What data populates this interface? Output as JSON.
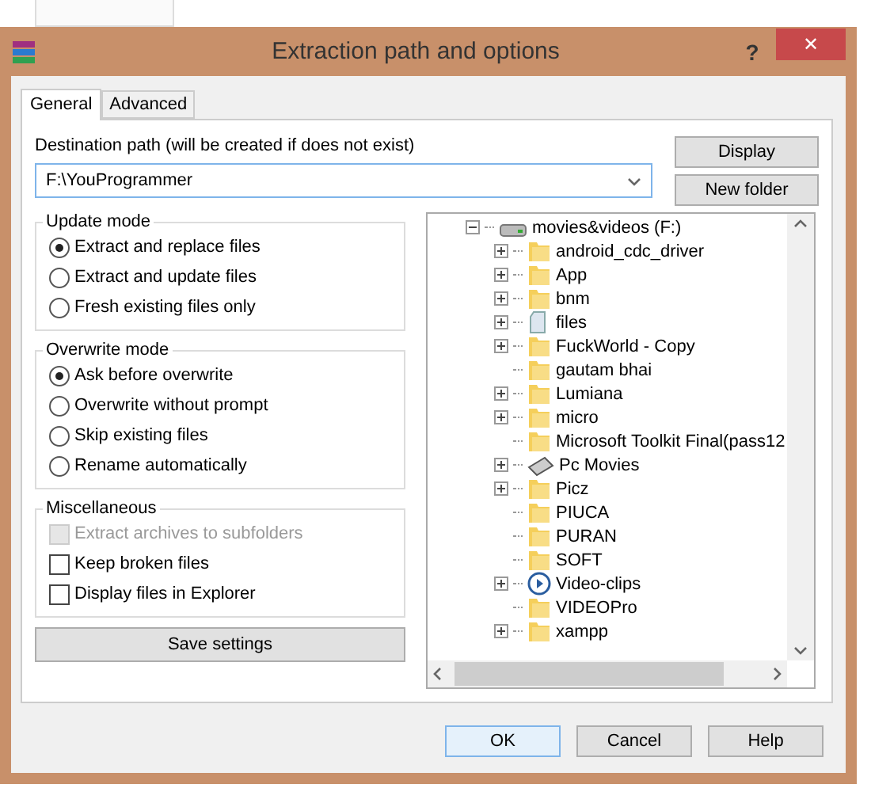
{
  "window": {
    "title": "Extraction path and options",
    "help_label": "?",
    "close_label": "✕"
  },
  "tabs": [
    {
      "label": "General",
      "selected": true
    },
    {
      "label": "Advanced",
      "selected": false
    }
  ],
  "destination": {
    "label": "Destination path (will be created if does not exist)",
    "value": "F:\\YouProgrammer"
  },
  "side_buttons": [
    "Display",
    "New folder"
  ],
  "groups": [
    {
      "title": "Update mode",
      "options": [
        {
          "kind": "radio",
          "label": "Extract and replace files",
          "selected": true,
          "disabled": false
        },
        {
          "kind": "radio",
          "label": "Extract and update files",
          "selected": false,
          "disabled": false
        },
        {
          "kind": "radio",
          "label": "Fresh existing files only",
          "selected": false,
          "disabled": false
        }
      ]
    },
    {
      "title": "Overwrite mode",
      "options": [
        {
          "kind": "radio",
          "label": "Ask before overwrite",
          "selected": true,
          "disabled": false
        },
        {
          "kind": "radio",
          "label": "Overwrite without prompt",
          "selected": false,
          "disabled": false
        },
        {
          "kind": "radio",
          "label": "Skip existing files",
          "selected": false,
          "disabled": false
        },
        {
          "kind": "radio",
          "label": "Rename automatically",
          "selected": false,
          "disabled": false
        }
      ]
    },
    {
      "title": "Miscellaneous",
      "options": [
        {
          "kind": "checkbox",
          "label": "Extract archives to subfolders",
          "checked": false,
          "disabled": true
        },
        {
          "kind": "checkbox",
          "label": "Keep broken files",
          "checked": false,
          "disabled": false
        },
        {
          "kind": "checkbox",
          "label": "Display files in Explorer",
          "checked": false,
          "disabled": false
        }
      ]
    }
  ],
  "save_button": "Save settings",
  "tree": [
    {
      "label": "movies&videos (F:)",
      "kind": "drive",
      "expanded": true,
      "children": [
        {
          "label": "android_cdc_driver",
          "kind": "folder",
          "expandable": true
        },
        {
          "label": "App",
          "kind": "folder",
          "expandable": true
        },
        {
          "label": "bnm",
          "kind": "folder",
          "expandable": true
        },
        {
          "label": "files",
          "kind": "document",
          "expandable": true
        },
        {
          "label": "FuckWorld - Copy",
          "kind": "folder",
          "expandable": true
        },
        {
          "label": "gautam bhai",
          "kind": "folder",
          "expandable": false
        },
        {
          "label": "Lumiana",
          "kind": "folder",
          "expandable": true
        },
        {
          "label": "micro",
          "kind": "folder",
          "expandable": true
        },
        {
          "label": "Microsoft Toolkit Final(pass12",
          "kind": "folder",
          "expandable": false
        },
        {
          "label": "Pc Movies",
          "kind": "disc",
          "expandable": true
        },
        {
          "label": "Picz",
          "kind": "folder",
          "expandable": true
        },
        {
          "label": "PIUCA",
          "kind": "folder",
          "expandable": false
        },
        {
          "label": "PURAN",
          "kind": "folder",
          "expandable": false
        },
        {
          "label": "SOFT",
          "kind": "folder",
          "expandable": false
        },
        {
          "label": "Video-clips",
          "kind": "media",
          "expandable": true
        },
        {
          "label": "VIDEOPro",
          "kind": "folder",
          "expandable": false
        },
        {
          "label": "xampp",
          "kind": "folder",
          "expandable": true
        }
      ]
    }
  ],
  "footer_buttons": [
    {
      "label": "OK",
      "default": true
    },
    {
      "label": "Cancel",
      "default": false
    },
    {
      "label": "Help",
      "default": false
    }
  ]
}
